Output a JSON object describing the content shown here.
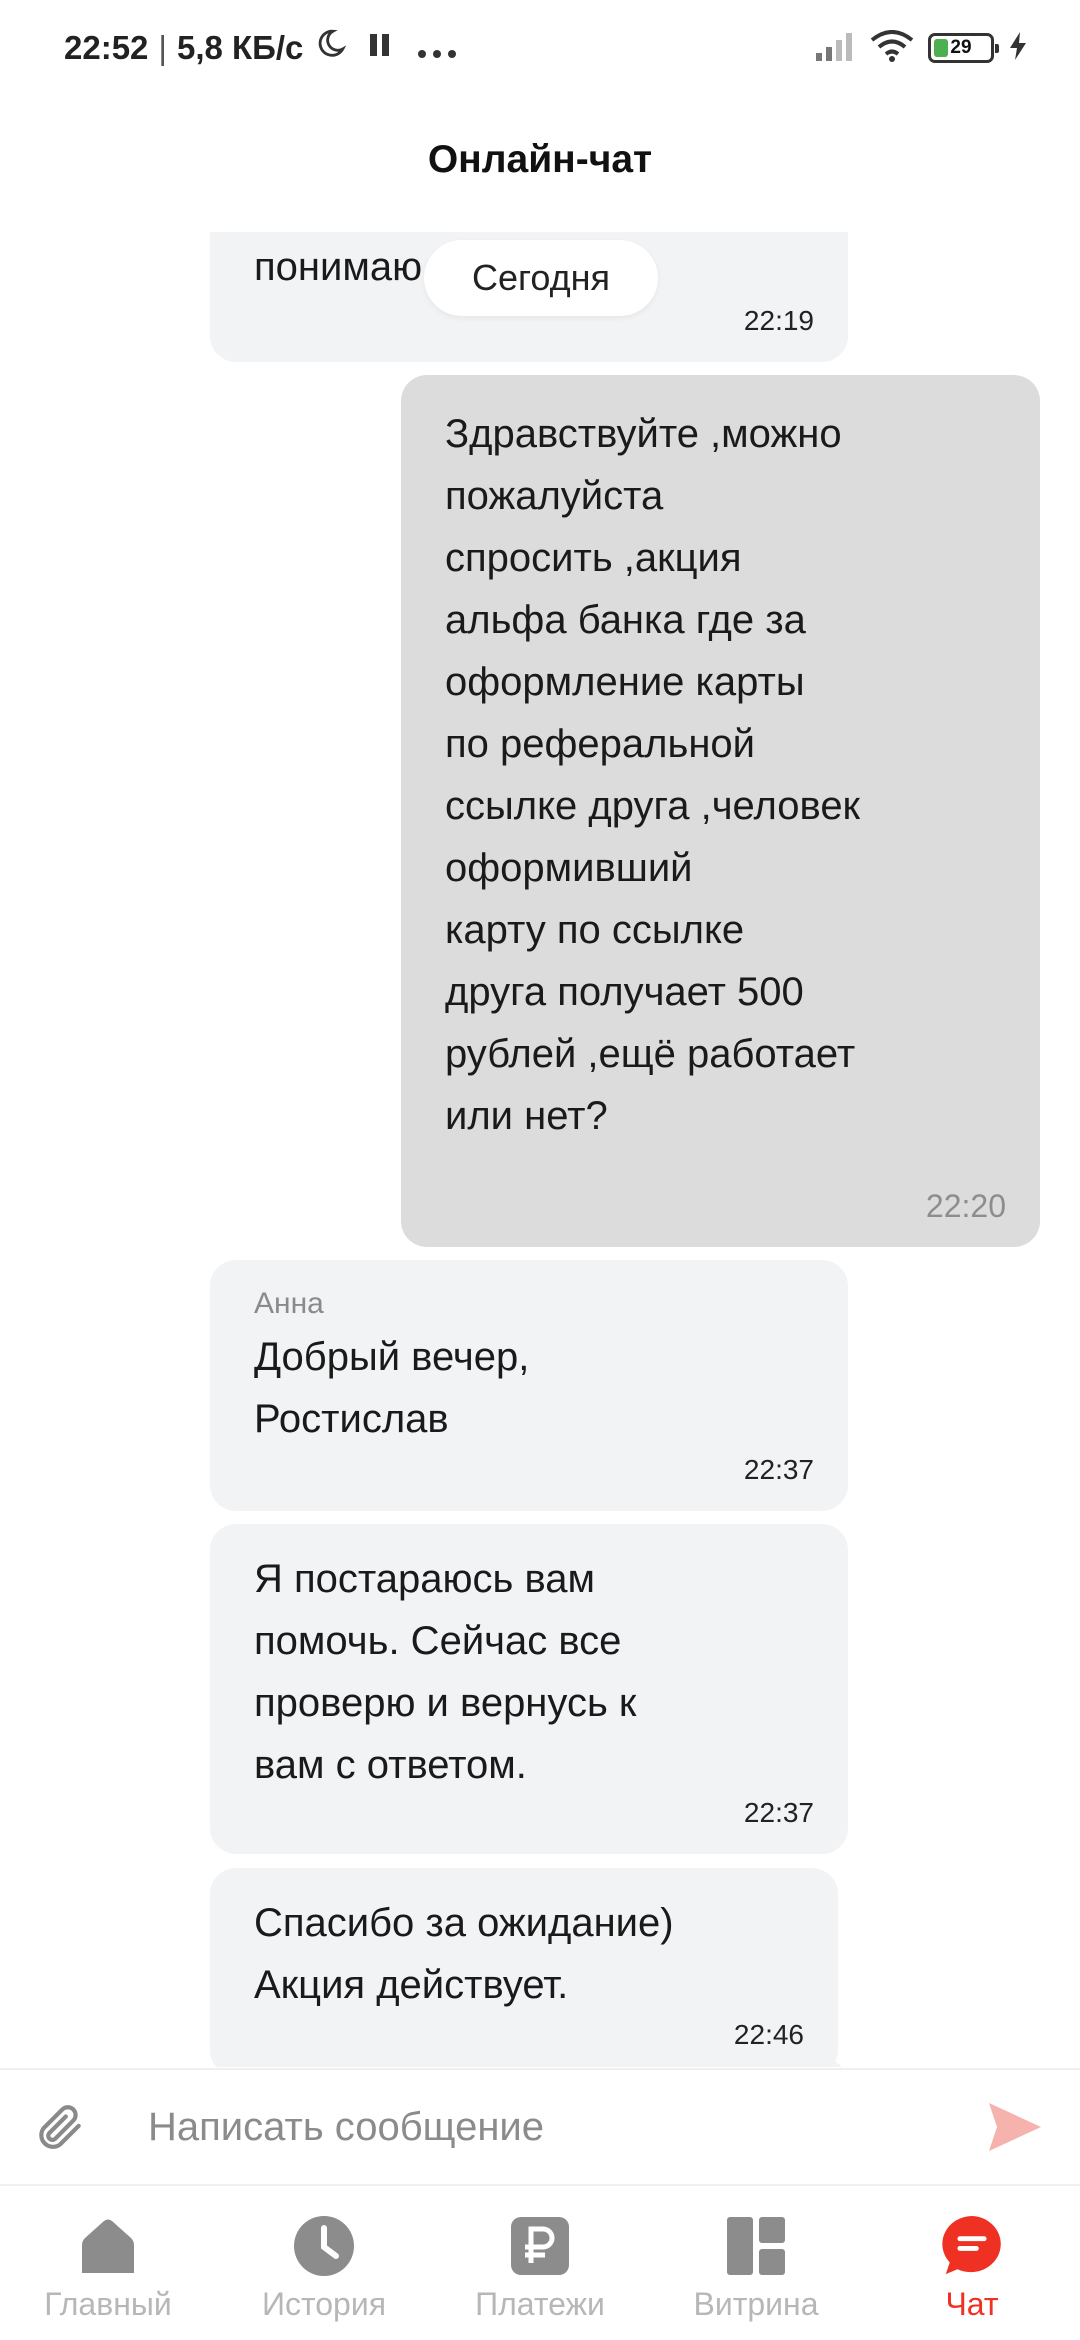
{
  "status_bar": {
    "time": "22:52",
    "separator": "|",
    "speed": "5,8 КБ/с",
    "battery": "29"
  },
  "header": {
    "title": "Онлайн-чат"
  },
  "chat": {
    "date_separator": "Сегодня",
    "messages": [
      {
        "direction": "in",
        "author": "",
        "text": "понимаю",
        "time": "22:19"
      },
      {
        "direction": "out",
        "author": "",
        "text": "Здравствуйте ,можно\nпожалуйста\nспросить ,акция\nальфа банка где за\nоформление карты\nпо реферальной\nссылке друга ,человек\nоформивший\nкарту по ссылке\nдруга получает 500\nрублей ,ещё работает\nили нет?",
        "time": "22:20"
      },
      {
        "direction": "in",
        "author": "Анна",
        "text": "Добрый вечер,\nРостислав",
        "time": "22:37"
      },
      {
        "direction": "in",
        "author": "",
        "text": "Я постараюсь вам\nпомочь. Сейчас все\nпроверю и вернусь к\nвам с ответом.",
        "time": "22:37"
      },
      {
        "direction": "in",
        "author": "",
        "text": "Спасибо за ожидание)\nАкция действует.",
        "time": "22:46"
      }
    ]
  },
  "composer": {
    "placeholder": "Написать сообщение"
  },
  "bottom_nav": {
    "items": [
      {
        "label": "Главный",
        "icon": "home-icon"
      },
      {
        "label": "История",
        "icon": "clock-icon"
      },
      {
        "label": "Платежи",
        "icon": "ruble-icon"
      },
      {
        "label": "Витрина",
        "icon": "showcase-icon"
      },
      {
        "label": "Чат",
        "icon": "chat-icon",
        "active": true
      }
    ]
  },
  "colors": {
    "accent": "#ef3124",
    "incoming_bubble": "#f2f3f5",
    "outgoing_bubble": "#dcdcdc",
    "inactive_nav": "#b7b7b7"
  }
}
